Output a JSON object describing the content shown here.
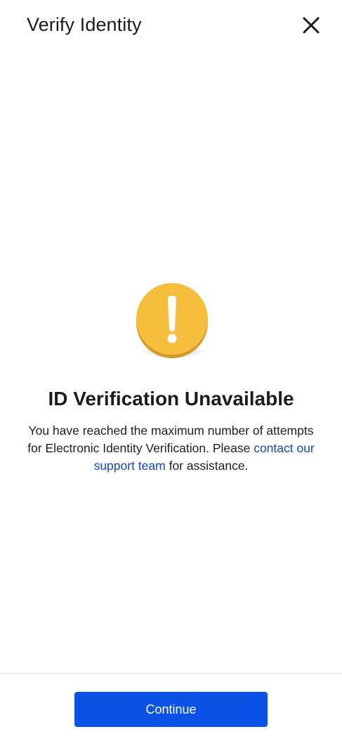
{
  "header": {
    "title": "Verify Identity",
    "close_icon": "close-icon"
  },
  "alert": {
    "icon": "exclamation-icon",
    "icon_color": "#F5BE3C",
    "title": "ID Verification Unavailable",
    "message_part1": "You have reached the maximum number of attempts for Electronic Identity Verification. Please ",
    "link_text": "contact our support team",
    "message_part2": " for assistance."
  },
  "footer": {
    "continue_label": "Continue",
    "button_color": "#0A52E6"
  }
}
